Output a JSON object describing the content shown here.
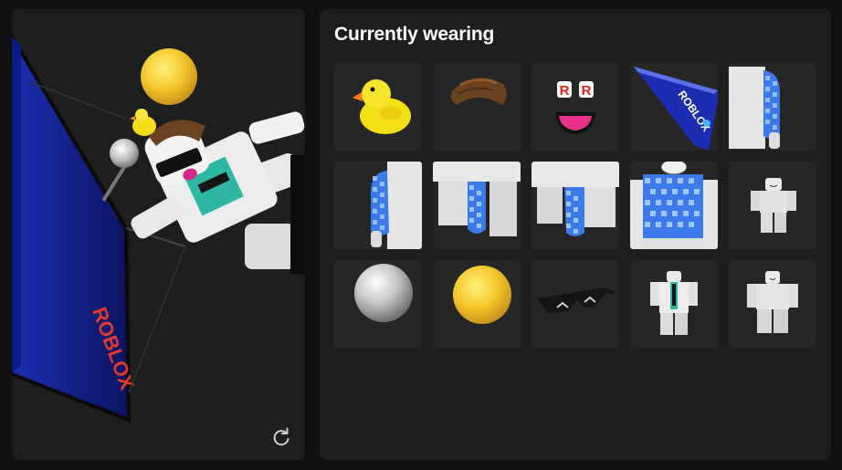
{
  "panel": {
    "title": "Currently wearing"
  },
  "viewer": {
    "rotate_icon": "rotate-icon"
  },
  "items": [
    {
      "name": "rubber-duck-hat",
      "icon": "duck-icon"
    },
    {
      "name": "brown-hair",
      "icon": "hair-icon"
    },
    {
      "name": "roblox-face",
      "icon": "face-icon"
    },
    {
      "name": "roblox-glider-back",
      "icon": "glider-icon"
    },
    {
      "name": "checkered-right-arm",
      "icon": "arm-icon"
    },
    {
      "name": "checkered-left-arm",
      "icon": "arm-icon"
    },
    {
      "name": "checkered-left-leg",
      "icon": "leg-icon"
    },
    {
      "name": "checkered-right-leg",
      "icon": "leg-icon"
    },
    {
      "name": "checkered-torso",
      "icon": "torso-icon"
    },
    {
      "name": "white-avatar-pose",
      "icon": "avatar-icon"
    },
    {
      "name": "silver-orb",
      "icon": "orb-icon"
    },
    {
      "name": "gold-orb",
      "icon": "orb-icon"
    },
    {
      "name": "black-shades",
      "icon": "glasses-icon"
    },
    {
      "name": "lab-coat-shirt",
      "icon": "shirt-icon"
    },
    {
      "name": "white-pants",
      "icon": "pants-icon"
    }
  ],
  "colors": {
    "background": "#111112",
    "panel": "#1e1e1f",
    "tile": "#262627",
    "checker_blue": "#3b7ae8",
    "body_white": "#e4e4e4",
    "gold": "#f2c52b",
    "teal": "#2fb7a6"
  }
}
